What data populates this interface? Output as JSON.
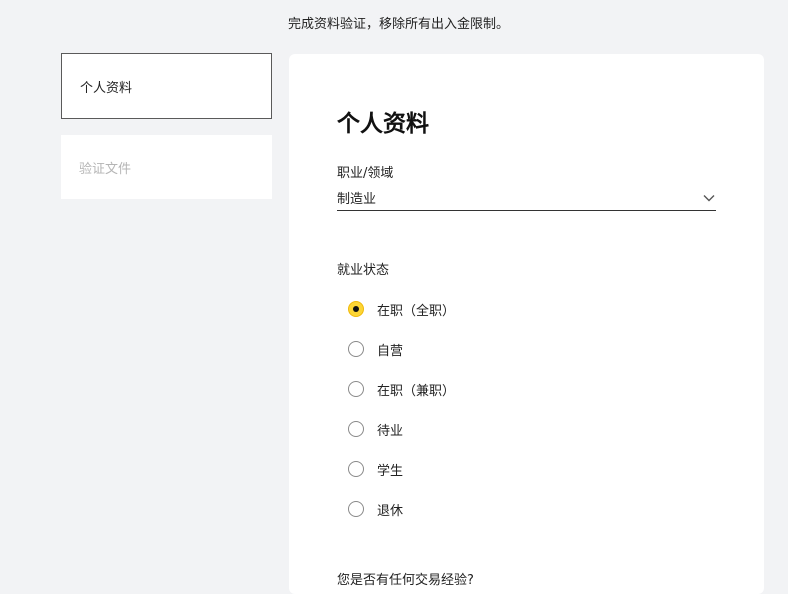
{
  "top_notice": "完成资料验证，移除所有出入金限制。",
  "steps": [
    {
      "label": "个人资料",
      "state": "active"
    },
    {
      "label": "验证文件",
      "state": "inactive"
    }
  ],
  "form": {
    "title": "个人资料",
    "occupation": {
      "label": "职业/领域",
      "value": "制造业",
      "icon": "chevron-down-icon"
    },
    "employment": {
      "label": "就业状态",
      "options": [
        {
          "label": "在职（全职）",
          "checked": true
        },
        {
          "label": "自营",
          "checked": false
        },
        {
          "label": "在职（兼职）",
          "checked": false
        },
        {
          "label": "待业",
          "checked": false
        },
        {
          "label": "学生",
          "checked": false
        },
        {
          "label": "退休",
          "checked": false
        }
      ]
    },
    "next_question": "您是否有任何交易经验?"
  },
  "colors": {
    "background": "#f2f3f5",
    "card": "#ffffff",
    "radio_selected_fill": "#fcd535",
    "inactive_text": "#b5b5b5"
  }
}
